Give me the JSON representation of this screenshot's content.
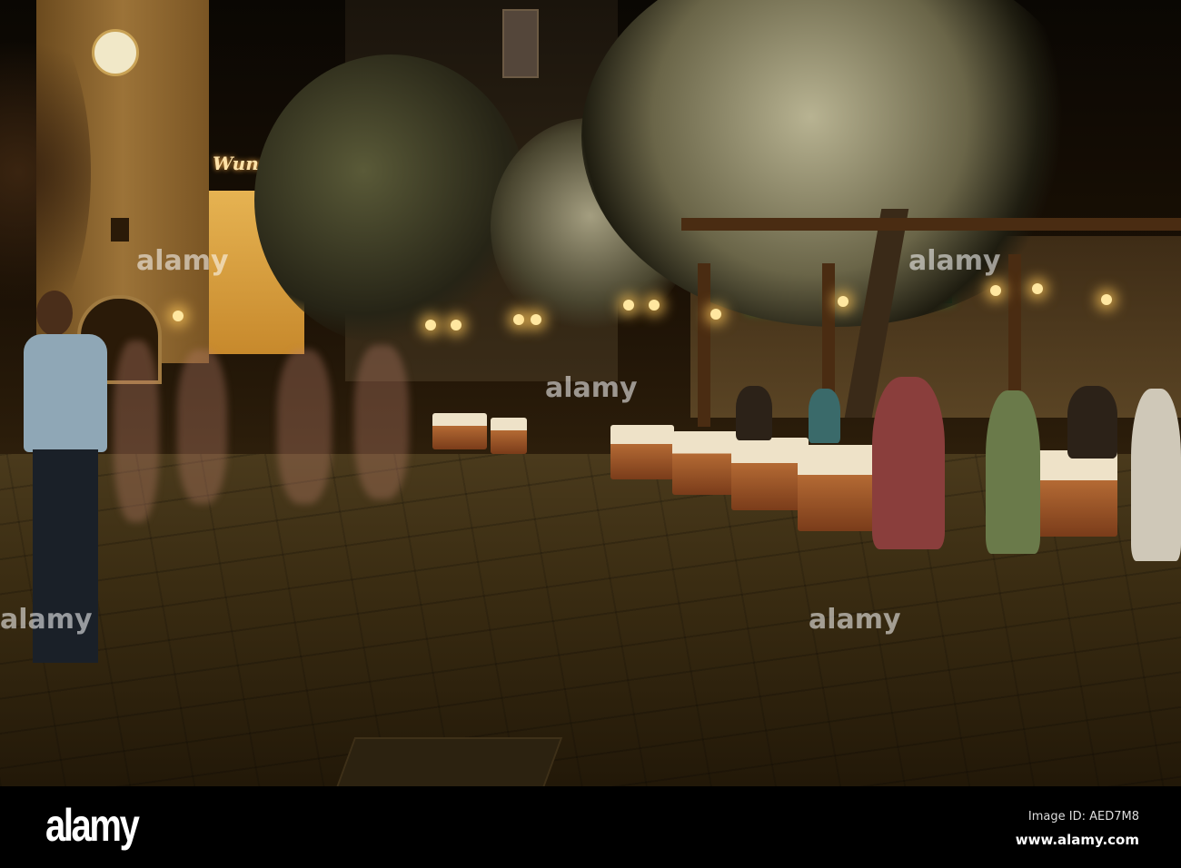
{
  "photo": {
    "sign_text": "Wunder",
    "watermark": "alamy"
  },
  "footer": {
    "logo": "alamy",
    "image_id": "Image ID: AED7M8",
    "website": "www.alamy.com"
  }
}
